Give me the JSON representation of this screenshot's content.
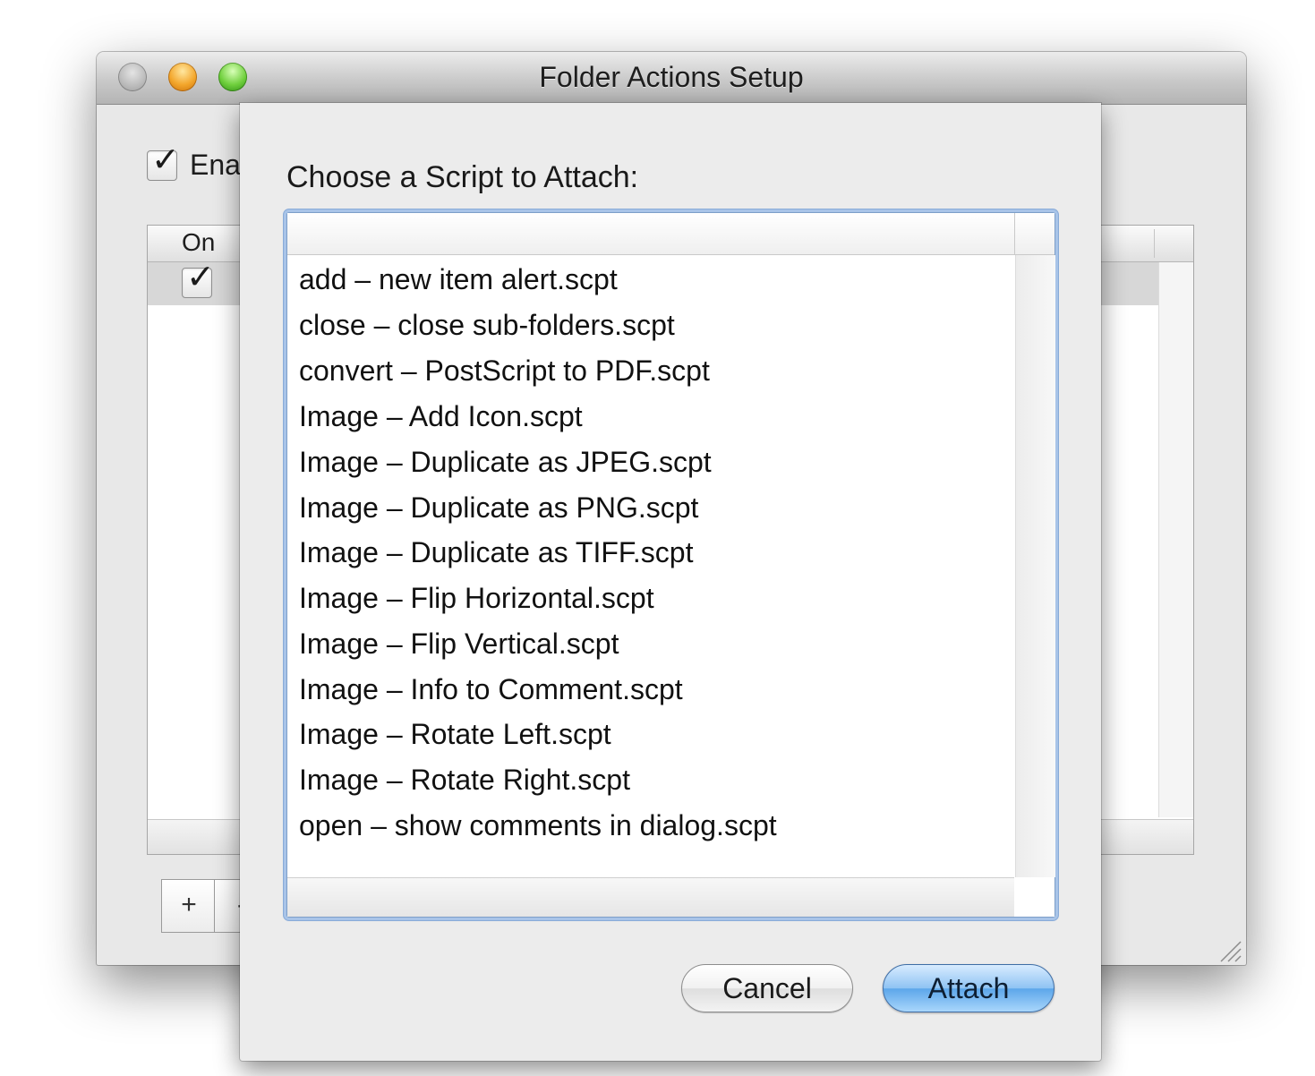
{
  "window": {
    "title": "Folder Actions Setup",
    "enable_label": "Ena",
    "enable_checked": true,
    "table_header_on": "On",
    "row_checked": true,
    "add_label": "+",
    "remove_label": "-"
  },
  "sheet": {
    "heading": "Choose a Script to Attach:",
    "scripts": [
      "add – new item alert.scpt",
      "close – close sub-folders.scpt",
      "convert – PostScript to PDF.scpt",
      "Image – Add Icon.scpt",
      "Image – Duplicate as JPEG.scpt",
      "Image – Duplicate as PNG.scpt",
      "Image – Duplicate as TIFF.scpt",
      "Image – Flip Horizontal.scpt",
      "Image – Flip Vertical.scpt",
      "Image – Info to Comment.scpt",
      "Image – Rotate Left.scpt",
      "Image – Rotate Right.scpt",
      "open – show comments in dialog.scpt"
    ],
    "cancel_label": "Cancel",
    "attach_label": "Attach"
  },
  "icons": {
    "checkmark": "checkmark-icon",
    "resize": "resize-grip-icon"
  },
  "colors": {
    "focus_ring": "#a8c4e8",
    "default_button": "#5ca6ea",
    "close_light": "#b9b9b9",
    "minimize_light": "#f3a62b",
    "zoom_light": "#6fcf3c"
  }
}
